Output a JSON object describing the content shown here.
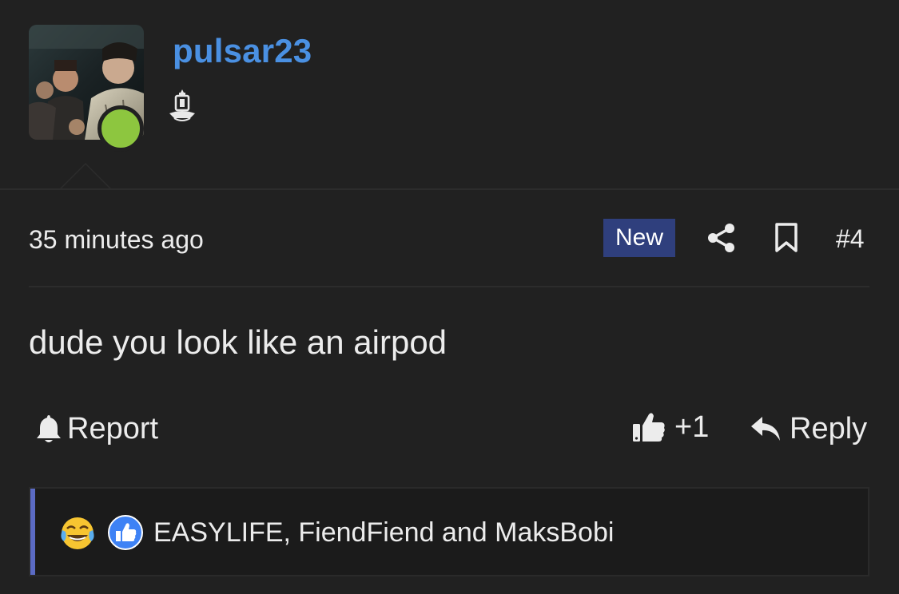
{
  "post": {
    "username": "pulsar23",
    "online": true,
    "time": "35 minutes ago",
    "new_label": "New",
    "post_number": "#4",
    "message": "dude you look like an airpod"
  },
  "actions": {
    "report_label": "Report",
    "like_count": "+1",
    "reply_label": "Reply"
  },
  "reactions": {
    "emojis": [
      "joy-tears-icon",
      "like-icon"
    ],
    "reactors": "EASYLIFE, FiendFiend and MaksBobi"
  },
  "colors": {
    "background": "#212121",
    "username": "#4a90e2",
    "online": "#8dc63f",
    "new_badge": "#2f3f7d",
    "reaction_bar": "#5b6bc4"
  }
}
